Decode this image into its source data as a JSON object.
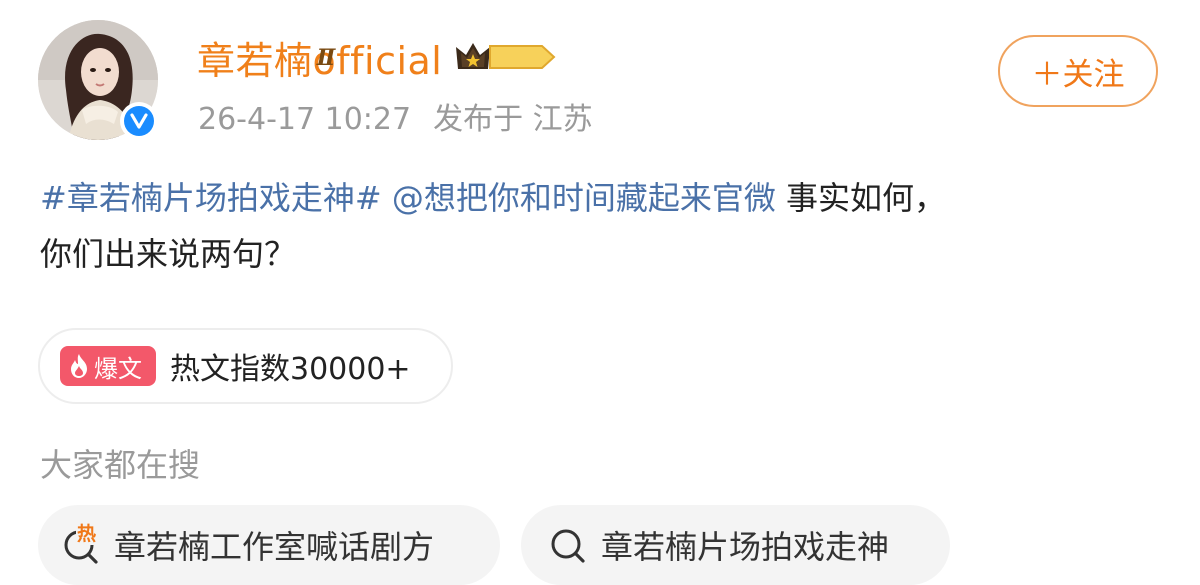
{
  "post": {
    "author": {
      "name": "章若楠official",
      "badge_level": "Ⅱ"
    },
    "meta": {
      "time": "26-4-17 10:27",
      "location": "发布于 江苏"
    },
    "follow_label": "＋关注",
    "content": {
      "hashtag": "#章若楠片场拍戏走神#",
      "mention": "@想把你和时间藏起来官微",
      "text_line1_rest": " 事实如何，",
      "text_line2": "你们出来说两句？"
    },
    "hot_index": {
      "badge": "爆文",
      "label": "热文指数30000+"
    }
  },
  "search_section": {
    "heading": "大家都在搜",
    "items": [
      {
        "text": "章若楠工作室喊话剧方",
        "icon": "hot-search-icon",
        "hot_mark": "热"
      },
      {
        "text": "章若楠片场拍戏走神",
        "icon": "search-icon"
      }
    ]
  },
  "colors": {
    "username": "#f0801a",
    "link": "#4a71a8",
    "follow_border": "#f0a35e",
    "badge_red": "#f3586a",
    "verified_blue": "#1a8cff"
  }
}
